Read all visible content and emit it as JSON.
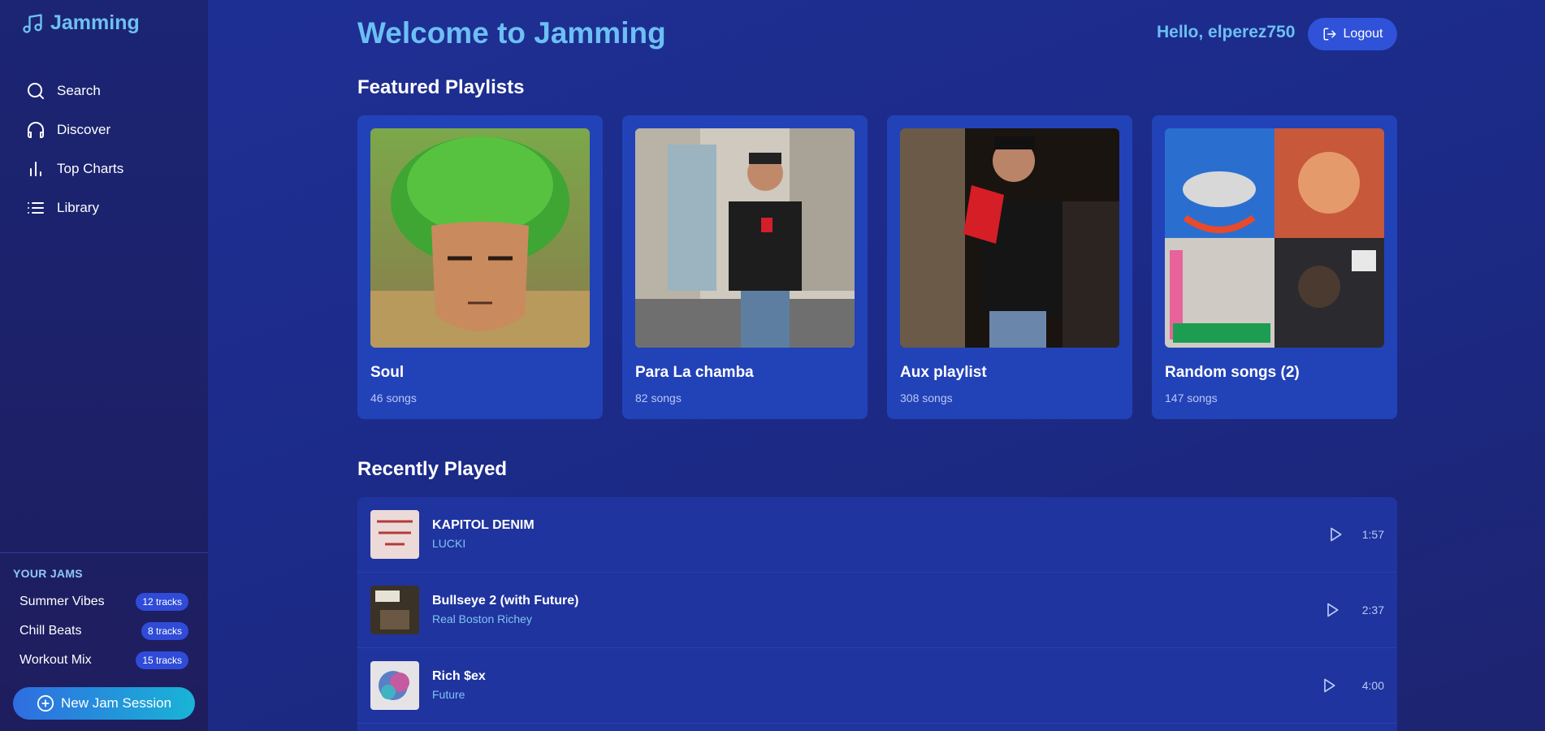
{
  "app": {
    "name": "Jamming"
  },
  "nav": {
    "items": [
      {
        "label": "Search",
        "icon": "search-icon"
      },
      {
        "label": "Discover",
        "icon": "headphones-icon"
      },
      {
        "label": "Top Charts",
        "icon": "bar-chart-icon"
      },
      {
        "label": "Library",
        "icon": "list-icon"
      }
    ]
  },
  "jams": {
    "title": "YOUR JAMS",
    "items": [
      {
        "name": "Summer Vibes",
        "tracks": "12 tracks"
      },
      {
        "name": "Chill Beats",
        "tracks": "8 tracks"
      },
      {
        "name": "Workout Mix",
        "tracks": "15 tracks"
      }
    ],
    "new_button": "New Jam Session"
  },
  "header": {
    "welcome": "Welcome to Jamming",
    "greeting": "Hello, elperez750",
    "logout_label": "Logout"
  },
  "featured": {
    "title": "Featured Playlists",
    "playlists": [
      {
        "title": "Soul",
        "count": "46 songs"
      },
      {
        "title": "Para La chamba",
        "count": "82 songs"
      },
      {
        "title": "Aux playlist",
        "count": "308 songs"
      },
      {
        "title": "Random songs (2)",
        "count": "147 songs"
      }
    ]
  },
  "recent": {
    "title": "Recently Played",
    "tracks": [
      {
        "title": "KAPITOL DENIM",
        "artist": "LUCKI",
        "duration": "1:57"
      },
      {
        "title": "Bullseye 2 (with Future)",
        "artist": "Real Boston Richey",
        "duration": "2:37"
      },
      {
        "title": "Rich $ex",
        "artist": "Future",
        "duration": "4:00"
      }
    ]
  },
  "colors": {
    "accent": "#6cbff4",
    "card": "#2242b8",
    "button": "#2f52d8"
  }
}
